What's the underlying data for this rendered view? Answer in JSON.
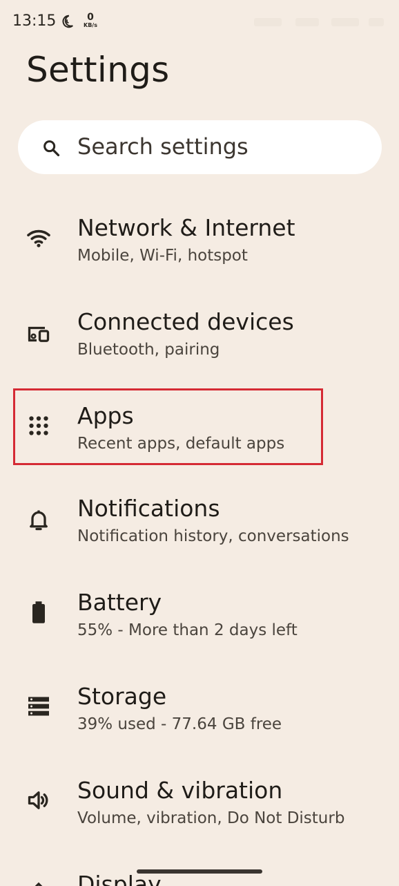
{
  "status_bar": {
    "time": "13:15",
    "net_speed_value": "0",
    "net_speed_unit": "KB/s"
  },
  "page": {
    "title": "Settings"
  },
  "search": {
    "placeholder": "Search settings"
  },
  "items": [
    {
      "id": "network",
      "title": "Network & Internet",
      "subtitle": "Mobile, Wi-Fi, hotspot",
      "icon": "wifi-icon"
    },
    {
      "id": "connected-devices",
      "title": "Connected devices",
      "subtitle": "Bluetooth, pairing",
      "icon": "devices-icon"
    },
    {
      "id": "apps",
      "title": "Apps",
      "subtitle": "Recent apps, default apps",
      "icon": "apps-grid-icon",
      "highlighted": true
    },
    {
      "id": "notifications",
      "title": "Notifications",
      "subtitle": "Notification history, conversations",
      "icon": "bell-icon"
    },
    {
      "id": "battery",
      "title": "Battery",
      "subtitle": "55% - More than 2 days left",
      "icon": "battery-icon"
    },
    {
      "id": "storage",
      "title": "Storage",
      "subtitle": "39% used - 77.64 GB free",
      "icon": "storage-icon"
    },
    {
      "id": "sound",
      "title": "Sound & vibration",
      "subtitle": "Volume, vibration, Do Not Disturb",
      "icon": "speaker-icon"
    },
    {
      "id": "display",
      "title": "Display",
      "subtitle": "",
      "icon": "display-icon"
    }
  ],
  "colors": {
    "background": "#f5ece3",
    "highlight": "#d52a34",
    "search_bg": "#ffffff"
  }
}
